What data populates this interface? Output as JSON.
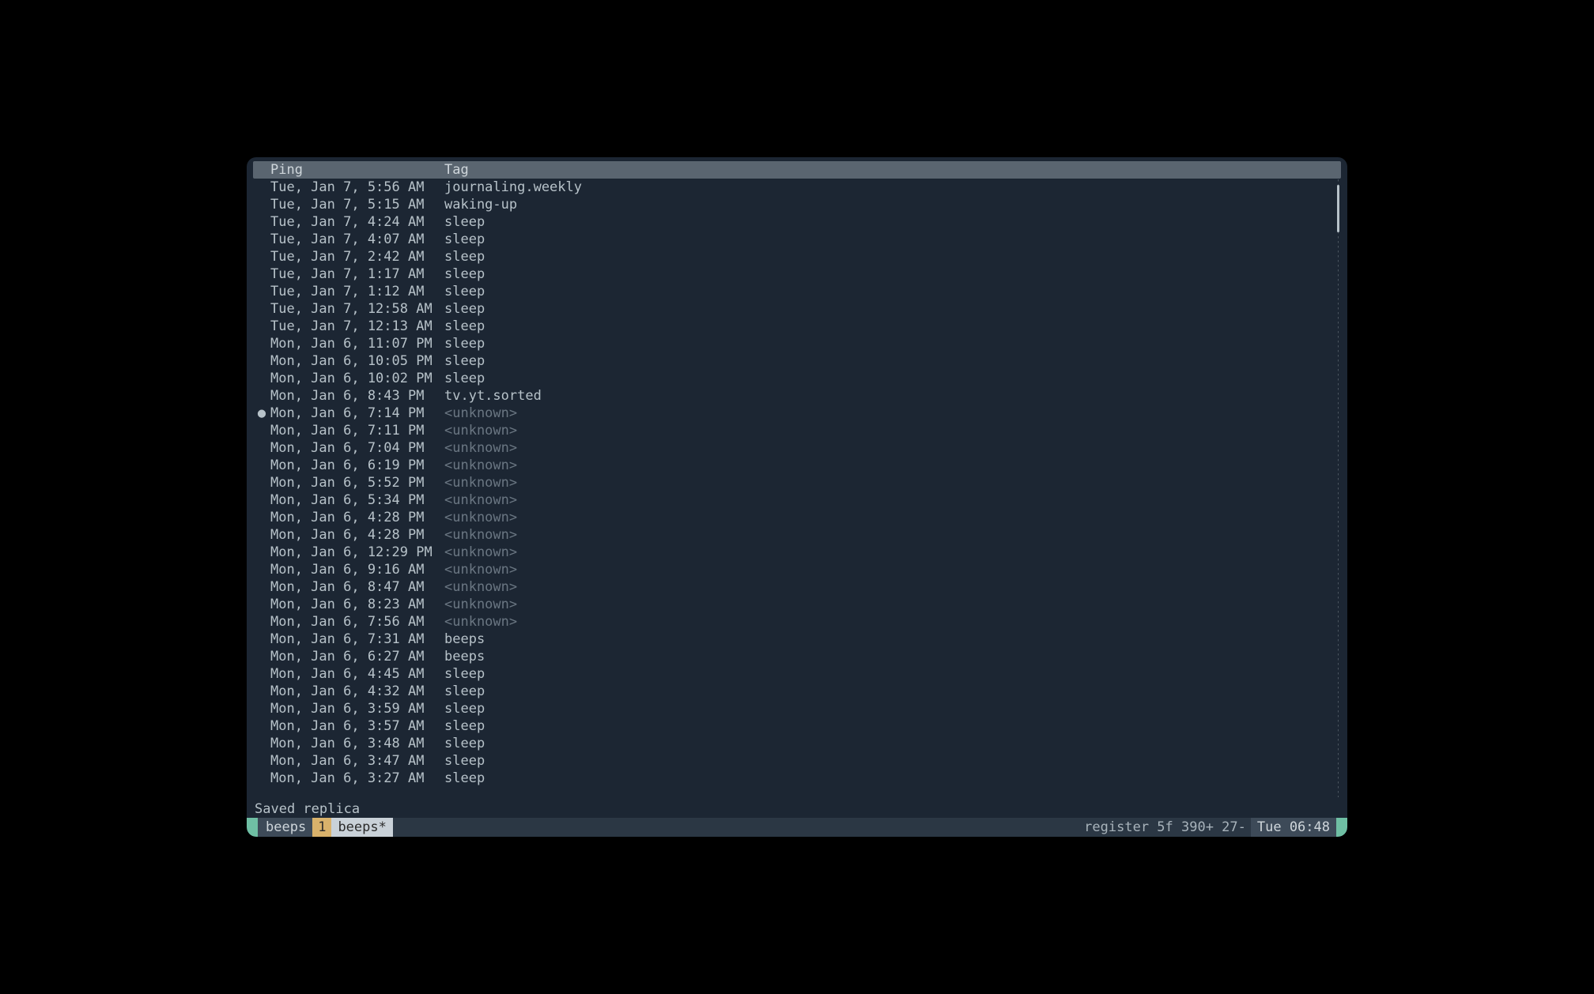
{
  "header": {
    "ping_label": "Ping",
    "tag_label": "Tag"
  },
  "rows": [
    {
      "marker": "",
      "ping": "Tue, Jan 7, 5:56 AM",
      "tag": "journaling.weekly",
      "unknown": false
    },
    {
      "marker": "",
      "ping": "Tue, Jan 7, 5:15 AM",
      "tag": "waking-up",
      "unknown": false
    },
    {
      "marker": "",
      "ping": "Tue, Jan 7, 4:24 AM",
      "tag": "sleep",
      "unknown": false
    },
    {
      "marker": "",
      "ping": "Tue, Jan 7, 4:07 AM",
      "tag": "sleep",
      "unknown": false
    },
    {
      "marker": "",
      "ping": "Tue, Jan 7, 2:42 AM",
      "tag": "sleep",
      "unknown": false
    },
    {
      "marker": "",
      "ping": "Tue, Jan 7, 1:17 AM",
      "tag": "sleep",
      "unknown": false
    },
    {
      "marker": "",
      "ping": "Tue, Jan 7, 1:12 AM",
      "tag": "sleep",
      "unknown": false
    },
    {
      "marker": "",
      "ping": "Tue, Jan 7, 12:58 AM",
      "tag": "sleep",
      "unknown": false
    },
    {
      "marker": "",
      "ping": "Tue, Jan 7, 12:13 AM",
      "tag": "sleep",
      "unknown": false
    },
    {
      "marker": "",
      "ping": "Mon, Jan 6, 11:07 PM",
      "tag": "sleep",
      "unknown": false
    },
    {
      "marker": "",
      "ping": "Mon, Jan 6, 10:05 PM",
      "tag": "sleep",
      "unknown": false
    },
    {
      "marker": "",
      "ping": "Mon, Jan 6, 10:02 PM",
      "tag": "sleep",
      "unknown": false
    },
    {
      "marker": "",
      "ping": "Mon, Jan 6, 8:43 PM",
      "tag": "tv.yt.sorted",
      "unknown": false
    },
    {
      "marker": "●",
      "ping": "Mon, Jan 6, 7:14 PM",
      "tag": "<unknown>",
      "unknown": true
    },
    {
      "marker": "",
      "ping": "Mon, Jan 6, 7:11 PM",
      "tag": "<unknown>",
      "unknown": true
    },
    {
      "marker": "",
      "ping": "Mon, Jan 6, 7:04 PM",
      "tag": "<unknown>",
      "unknown": true
    },
    {
      "marker": "",
      "ping": "Mon, Jan 6, 6:19 PM",
      "tag": "<unknown>",
      "unknown": true
    },
    {
      "marker": "",
      "ping": "Mon, Jan 6, 5:52 PM",
      "tag": "<unknown>",
      "unknown": true
    },
    {
      "marker": "",
      "ping": "Mon, Jan 6, 5:34 PM",
      "tag": "<unknown>",
      "unknown": true
    },
    {
      "marker": "",
      "ping": "Mon, Jan 6, 4:28 PM",
      "tag": "<unknown>",
      "unknown": true
    },
    {
      "marker": "",
      "ping": "Mon, Jan 6, 4:28 PM",
      "tag": "<unknown>",
      "unknown": true
    },
    {
      "marker": "",
      "ping": "Mon, Jan 6, 12:29 PM",
      "tag": "<unknown>",
      "unknown": true
    },
    {
      "marker": "",
      "ping": "Mon, Jan 6, 9:16 AM",
      "tag": "<unknown>",
      "unknown": true
    },
    {
      "marker": "",
      "ping": "Mon, Jan 6, 8:47 AM",
      "tag": "<unknown>",
      "unknown": true
    },
    {
      "marker": "",
      "ping": "Mon, Jan 6, 8:23 AM",
      "tag": "<unknown>",
      "unknown": true
    },
    {
      "marker": "",
      "ping": "Mon, Jan 6, 7:56 AM",
      "tag": "<unknown>",
      "unknown": true
    },
    {
      "marker": "",
      "ping": "Mon, Jan 6, 7:31 AM",
      "tag": "beeps",
      "unknown": false
    },
    {
      "marker": "",
      "ping": "Mon, Jan 6, 6:27 AM",
      "tag": "beeps",
      "unknown": false
    },
    {
      "marker": "",
      "ping": "Mon, Jan 6, 4:45 AM",
      "tag": "sleep",
      "unknown": false
    },
    {
      "marker": "",
      "ping": "Mon, Jan 6, 4:32 AM",
      "tag": "sleep",
      "unknown": false
    },
    {
      "marker": "",
      "ping": "Mon, Jan 6, 3:59 AM",
      "tag": "sleep",
      "unknown": false
    },
    {
      "marker": "",
      "ping": "Mon, Jan 6, 3:57 AM",
      "tag": "sleep",
      "unknown": false
    },
    {
      "marker": "",
      "ping": "Mon, Jan 6, 3:48 AM",
      "tag": "sleep",
      "unknown": false
    },
    {
      "marker": "",
      "ping": "Mon, Jan 6, 3:47 AM",
      "tag": "sleep",
      "unknown": false
    },
    {
      "marker": "",
      "ping": "Mon, Jan 6, 3:27 AM",
      "tag": "sleep",
      "unknown": false
    }
  ],
  "status_line": "Saved replica",
  "bottom_bar": {
    "session": "beeps",
    "window_number": "1",
    "window_name": "beeps*",
    "status": "register 5f 390+ 27-",
    "clock": "Tue 06:48"
  }
}
